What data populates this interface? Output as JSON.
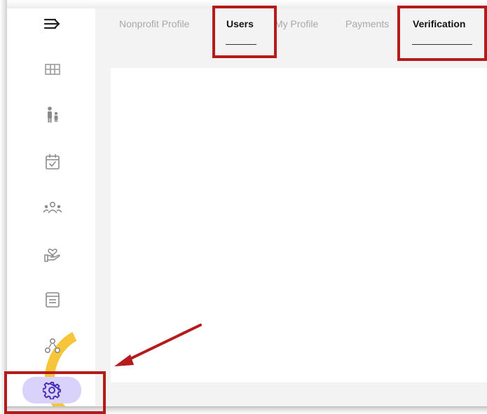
{
  "tabs": [
    {
      "label": "Nonprofit Profile",
      "active": false
    },
    {
      "label": "Users",
      "active": true
    },
    {
      "label": "My Profile",
      "active": false
    },
    {
      "label": "Payments",
      "active": false
    },
    {
      "label": "Verification",
      "active": true
    }
  ],
  "sidebar": {
    "items": [
      {
        "icon": "collapse-menu-icon"
      },
      {
        "icon": "dashboard-grid-icon"
      },
      {
        "icon": "people-icon"
      },
      {
        "icon": "calendar-check-icon"
      },
      {
        "icon": "group-icon"
      },
      {
        "icon": "hand-heart-icon"
      },
      {
        "icon": "document-list-icon"
      },
      {
        "icon": "network-nodes-icon"
      },
      {
        "icon": "settings-gear-icon",
        "active": true
      }
    ]
  },
  "annotation": {
    "highlight_color": "#b51b1b",
    "arrow_color": "#b51b1b"
  },
  "colors": {
    "active_nav_bg": "#d9d3fb",
    "icon_color": "#9a9a9a",
    "active_icon_color": "#5a3fc0",
    "decor_ring": "#f7c230"
  }
}
